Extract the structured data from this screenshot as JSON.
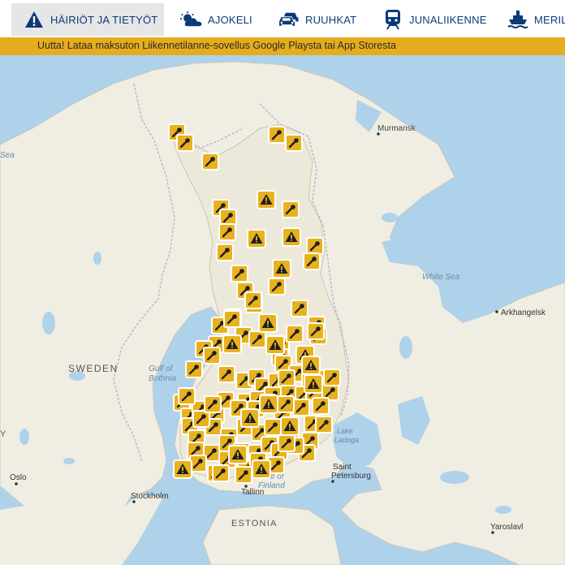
{
  "nav": {
    "tabs": [
      {
        "label": "HÄIRIÖT JA TIETYÖT",
        "icon": "warning-triangle-icon",
        "active": true
      },
      {
        "label": "AJOKELI",
        "icon": "weather-sun-cloud-icon",
        "active": false
      },
      {
        "label": "RUUHKAT",
        "icon": "traffic-cars-icon",
        "active": false
      },
      {
        "label": "JUNALIIKENNE",
        "icon": "train-icon",
        "active": false
      },
      {
        "label": "MERIL",
        "icon": "ship-icon",
        "active": false
      }
    ]
  },
  "banner": {
    "text": "Uutta! Lataa maksuton Liikennetilanne-sovellus Google Playsta tai App Storesta"
  },
  "map": {
    "labels": {
      "murmansk": "Murmansk",
      "white_sea": "White Sea",
      "arkhangelsk": "Arkhangelsk",
      "sweden": "SWEDEN",
      "gulf_bothnia_1": "Gulf of",
      "gulf_bothnia_2": "Bothnia",
      "lake_ladoga_1": "Lake",
      "lake_ladoga_2": "Ladoga",
      "saint_1": "Saint",
      "saint_2": "Petersburg",
      "oslo": "Oslo",
      "stockholm": "Stockholm",
      "tallinn": "Tallinn",
      "gulf_finland_1": "Gulf of",
      "gulf_finland_2": "Finland",
      "estonia": "ESTONIA",
      "yaroslavl": "Yaroslavl",
      "sea_left": "Sea",
      "y_left": "Y"
    },
    "colors": {
      "sea": "#aed2ea",
      "land": "#f0ede2",
      "forest": "#dfe8c8",
      "marker": "#e8b21f",
      "marker_border": "#ffffff",
      "marker_icon": "#1f1f1f"
    },
    "markers": {
      "roadwork_count": 95,
      "warning_count": 16
    }
  }
}
